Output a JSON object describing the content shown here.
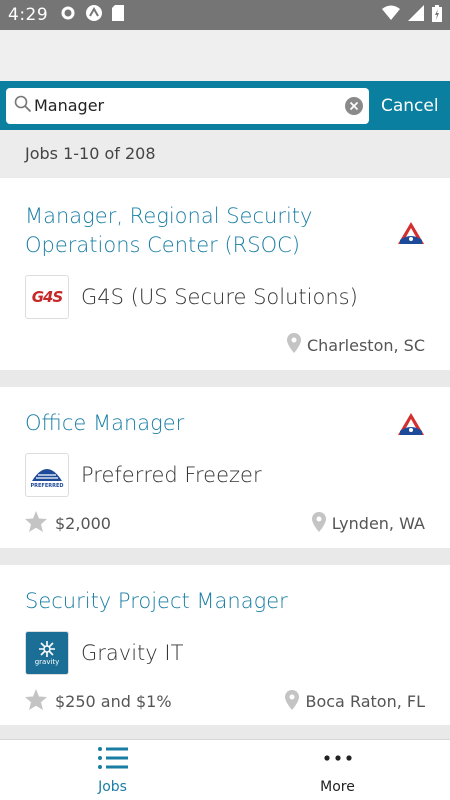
{
  "status_bar": {
    "time": "4:29"
  },
  "search": {
    "query": "Manager",
    "placeholder": "",
    "cancel_label": "Cancel"
  },
  "results": {
    "summary": "Jobs 1-10 of 208"
  },
  "jobs": [
    {
      "title_line1": "Manager, Regional Security",
      "title_line2": "Operations Center (RSOC)",
      "company": "G4S (US Secure Solutions)",
      "logo_text": "G4S",
      "salary": "",
      "location": "Charleston, SC"
    },
    {
      "title_line1": "Office Manager",
      "title_line2": "",
      "company": "Preferred Freezer",
      "logo_text": "PREFERRED",
      "salary": "$2,000",
      "location": "Lynden, WA"
    },
    {
      "title_line1": "Security Project Manager",
      "title_line2": "",
      "company": "Gravity IT",
      "logo_text": "gravity",
      "salary": "$250 and $1%",
      "location": "Boca Raton, FL"
    }
  ],
  "bottom_nav": {
    "jobs_label": "Jobs",
    "more_label": "More"
  },
  "colors": {
    "accent": "#0a7fa0",
    "title": "#1a7ea4",
    "status_bar": "#757575",
    "badge_red": "#d32f2f",
    "badge_blue": "#1e4a9a"
  }
}
